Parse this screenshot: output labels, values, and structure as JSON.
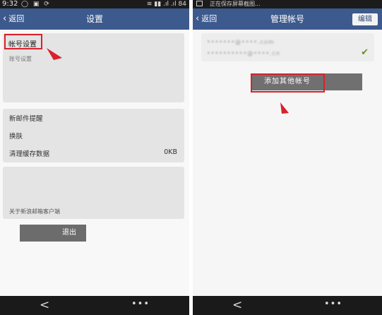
{
  "left": {
    "status": {
      "time": "9:32",
      "icons": "◯ ▣ ⟳",
      "right_info": "≋ ▮▮ .ıl .ıl 84"
    },
    "titlebar": {
      "back_label": "返回",
      "title": "设置"
    },
    "account_card": {
      "label": "帐号设置",
      "sub_label": "账号设置"
    },
    "settings_card": {
      "rows": [
        {
          "label": "新邮件提醒",
          "value": ""
        },
        {
          "label": "换肤",
          "value": ""
        },
        {
          "label": "清理缓存数据",
          "value": "0KB"
        }
      ]
    },
    "about_card": {
      "label": "关于新浪邮箱客户端"
    },
    "logout_label": "退出",
    "navbar": {
      "back_icon": "<",
      "menu_icon": "•••"
    }
  },
  "right": {
    "status": {
      "notification": "正在保存屏幕截图..."
    },
    "titlebar": {
      "back_label": "返回",
      "title": "管理帐号",
      "edit_label": "编辑"
    },
    "accounts": [
      {
        "email": "•••••••@••••.com",
        "selected": false
      },
      {
        "email": "••••••••••@••••.cn",
        "selected": true
      }
    ],
    "check_icon": "✔",
    "add_account_label": "添加其他帐号",
    "navbar": {
      "back_icon": "<",
      "menu_icon": "•••"
    }
  },
  "colors": {
    "title_bar": "#3d5a8e",
    "highlight": "#d9212c",
    "card": "#e4e4e4",
    "button": "#6c6c6c",
    "check": "#6b8e23"
  }
}
